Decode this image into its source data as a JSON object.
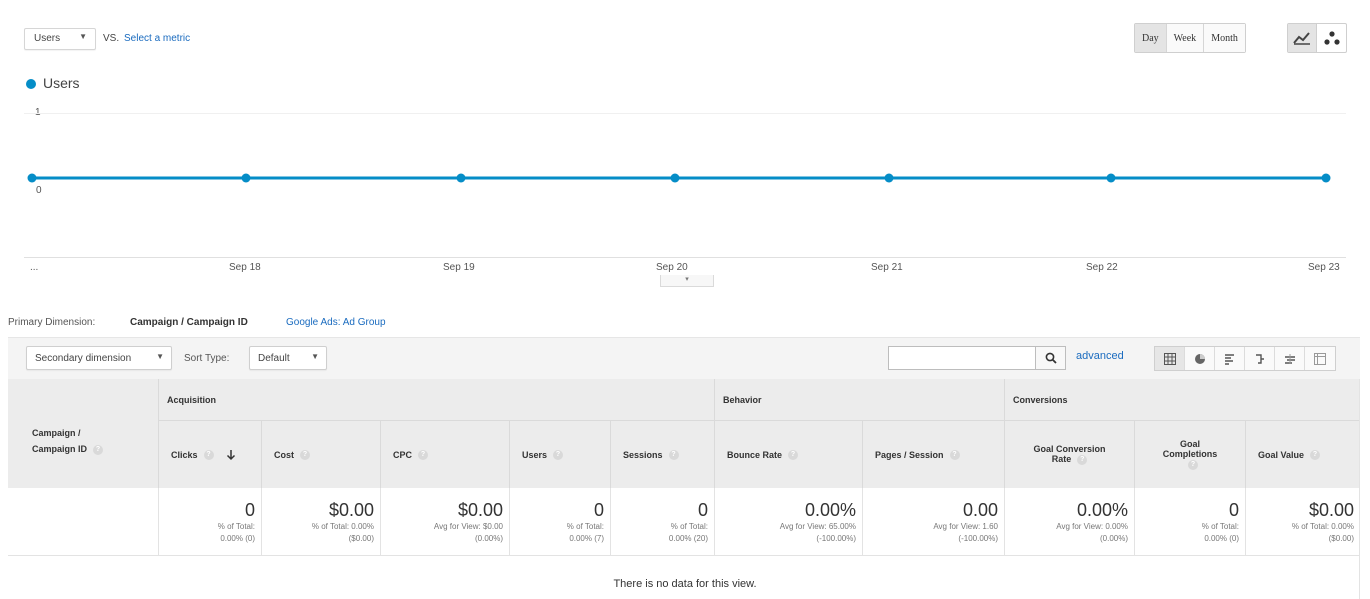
{
  "top_bar": {
    "metric_select": "Users",
    "vs": "VS.",
    "select_metric": "Select a metric",
    "periods": [
      "Day",
      "Week",
      "Month"
    ],
    "active_period": "Day"
  },
  "chart": {
    "legend": "Users",
    "y_top": "1",
    "y_zero": "0",
    "x_labels": [
      "...",
      "Sep 18",
      "Sep 19",
      "Sep 20",
      "Sep 21",
      "Sep 22",
      "Sep 23"
    ],
    "series_color": "#058dc7"
  },
  "chart_data": {
    "type": "line",
    "title": "",
    "xlabel": "",
    "ylabel": "",
    "x": [
      "...",
      "Sep 18",
      "Sep 19",
      "Sep 20",
      "Sep 21",
      "Sep 22",
      "Sep 23"
    ],
    "series": [
      {
        "name": "Users",
        "values": [
          0,
          0,
          0,
          0,
          0,
          0,
          0
        ]
      }
    ],
    "ylim": [
      0,
      1
    ],
    "legend": "top-left",
    "grid": true
  },
  "dimension": {
    "label": "Primary Dimension:",
    "active": "Campaign / Campaign ID",
    "link": "Google Ads: Ad Group"
  },
  "toolbar": {
    "secondary_dimension": "Secondary dimension",
    "sort_type_label": "Sort Type:",
    "sort_type_value": "Default",
    "advanced": "advanced"
  },
  "table": {
    "campaign_header_line1": "Campaign /",
    "campaign_header_line2": "Campaign ID",
    "groups": {
      "acquisition": "Acquisition",
      "behavior": "Behavior",
      "conversions": "Conversions"
    },
    "columns": {
      "clicks": "Clicks",
      "cost": "Cost",
      "cpc": "CPC",
      "users": "Users",
      "sessions": "Sessions",
      "bounce_rate": "Bounce Rate",
      "pages_session": "Pages / Session",
      "goal_conv_rate_1": "Goal Conversion",
      "goal_conv_rate_2": "Rate",
      "goal_completions_1": "Goal",
      "goal_completions_2": "Completions",
      "goal_value": "Goal Value"
    },
    "totals": {
      "clicks": {
        "value": "0",
        "sub1": "% of Total:",
        "sub2": "0.00% (0)"
      },
      "cost": {
        "value": "$0.00",
        "sub1": "% of Total: 0.00%",
        "sub2": "($0.00)"
      },
      "cpc": {
        "value": "$0.00",
        "sub1": "Avg for View: $0.00",
        "sub2": "(0.00%)"
      },
      "users": {
        "value": "0",
        "sub1": "% of Total:",
        "sub2": "0.00% (7)"
      },
      "sessions": {
        "value": "0",
        "sub1": "% of Total:",
        "sub2": "0.00% (20)"
      },
      "bounce_rate": {
        "value": "0.00%",
        "sub1": "Avg for View: 65.00%",
        "sub2": "(-100.00%)"
      },
      "pages_session": {
        "value": "0.00",
        "sub1": "Avg for View: 1.60",
        "sub2": "(-100.00%)"
      },
      "goal_conv_rate": {
        "value": "0.00%",
        "sub1": "Avg for View: 0.00%",
        "sub2": "(0.00%)"
      },
      "goal_completions": {
        "value": "0",
        "sub1": "% of Total:",
        "sub2": "0.00% (0)"
      },
      "goal_value": {
        "value": "$0.00",
        "sub1": "% of Total: 0.00%",
        "sub2": "($0.00)"
      }
    },
    "no_data": "There is no data for this view."
  }
}
